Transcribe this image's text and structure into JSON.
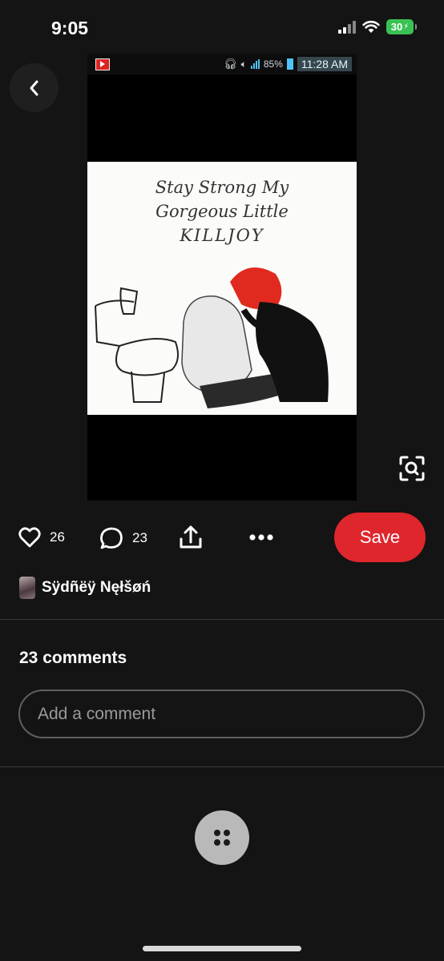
{
  "status_bar": {
    "time": "9:05",
    "battery": "30"
  },
  "pin": {
    "inner_status": {
      "battery_percent": "85%",
      "clock": "11:28 AM"
    },
    "image_text": {
      "line1": "Stay Strong My",
      "line2": "Gorgeous Little",
      "line3": "KILLJOY"
    }
  },
  "actions": {
    "likes": "26",
    "comments": "23",
    "save_label": "Save"
  },
  "author": {
    "name": "Sÿdñëÿ Nęłšøń"
  },
  "comments_section": {
    "title": "23 comments",
    "placeholder": "Add a comment"
  },
  "colors": {
    "background": "#141414",
    "save": "#e0262d",
    "battery": "#39c253"
  },
  "icons": {
    "back": "chevron-left-icon",
    "like": "heart-icon",
    "comment": "speech-bubble-icon",
    "share": "share-icon",
    "more": "ellipsis-icon",
    "visual_search": "lens-search-icon",
    "options": "four-dots-icon"
  }
}
